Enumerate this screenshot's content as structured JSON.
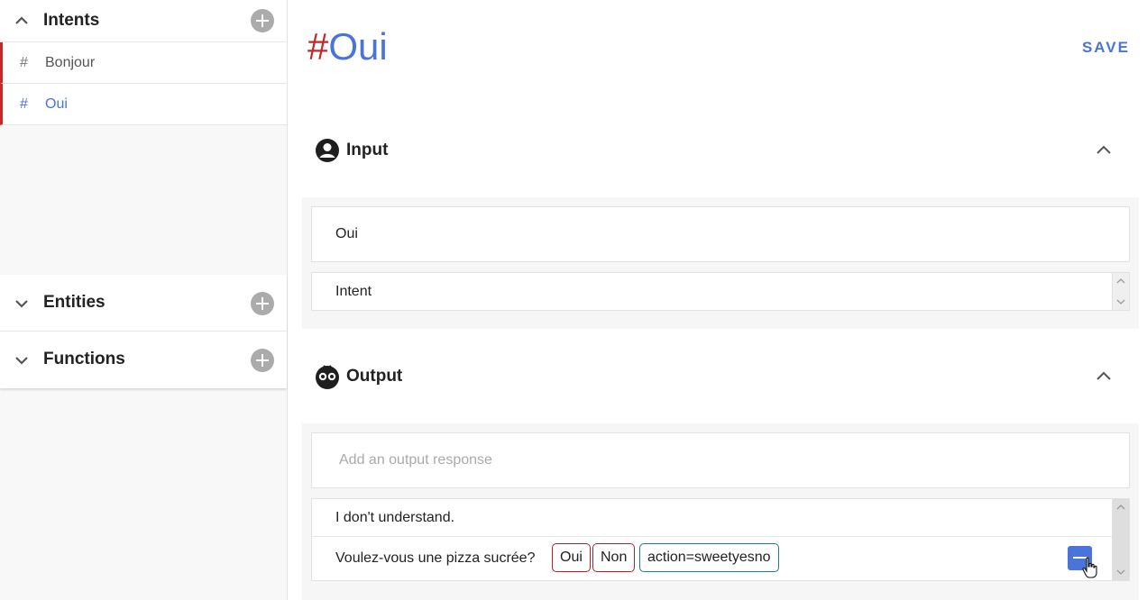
{
  "sidebar": {
    "intents": {
      "title": "Intents",
      "items": [
        {
          "hash": "#",
          "label": "Bonjour",
          "active": false
        },
        {
          "hash": "#",
          "label": "Oui",
          "active": true
        }
      ]
    },
    "entities": {
      "title": "Entities"
    },
    "functions": {
      "title": "Functions"
    }
  },
  "main": {
    "title_prefix": "#",
    "title": "Oui",
    "save_label": "SAVE",
    "input": {
      "title": "Input",
      "example_value": "Oui",
      "intent_value": "Intent"
    },
    "output": {
      "title": "Output",
      "add_placeholder": "Add an output response",
      "responses": [
        {
          "text": "I don't understand."
        },
        {
          "text": "Voulez-vous une pizza sucrée?",
          "chips": [
            "Oui",
            "Non",
            "action=sweetyesno"
          ]
        }
      ]
    }
  },
  "colors": {
    "accent": "#4a74d9",
    "intent_red": "#c62828",
    "chip_red": "#b51f2a",
    "chip_teal": "#1a7f8c"
  },
  "icons": [
    "chevron-up-icon",
    "chevron-down-icon",
    "plus-circle-icon",
    "user-circle-icon",
    "robot-face-icon",
    "minus-icon",
    "hand-cursor-icon"
  ]
}
